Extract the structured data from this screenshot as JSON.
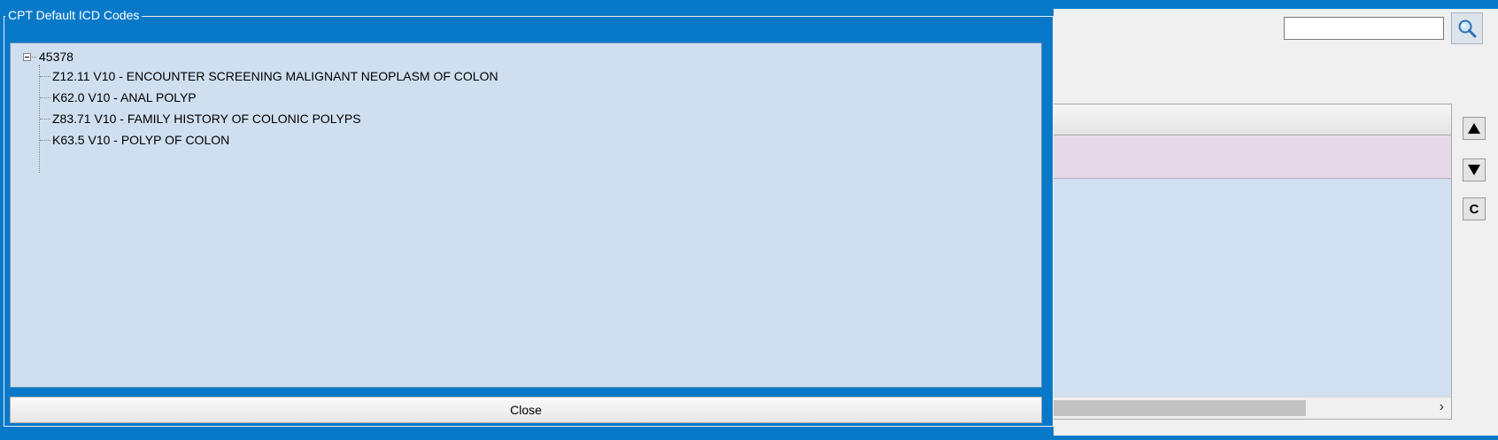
{
  "dialog": {
    "group_title": "CPT Default ICD Codes",
    "tree": {
      "root_label": "45378",
      "children": [
        {
          "label": "Z12.11 V10 - ENCOUNTER SCREENING MALIGNANT NEOPLASM OF COLON"
        },
        {
          "label": "K62.0 V10 - ANAL POLYP"
        },
        {
          "label": "Z83.71 V10 - FAMILY HISTORY OF COLONIC POLYPS"
        },
        {
          "label": "K63.5 V10 - POLYP OF COLON"
        }
      ]
    },
    "close_label": "Close"
  },
  "background_form": {
    "search": {
      "value": "",
      "placeholder": ""
    },
    "side_buttons": {
      "clear_label": "C"
    },
    "scroll_right_glyph": "›"
  },
  "colors": {
    "frame_blue": "#0879c8",
    "tree_background": "#cfdff0",
    "grid_row_background": "#e5d9e9"
  },
  "icons": [
    "search-icon",
    "collapse-icon",
    "arrow-up-icon",
    "arrow-down-icon",
    "chevron-right-icon"
  ]
}
